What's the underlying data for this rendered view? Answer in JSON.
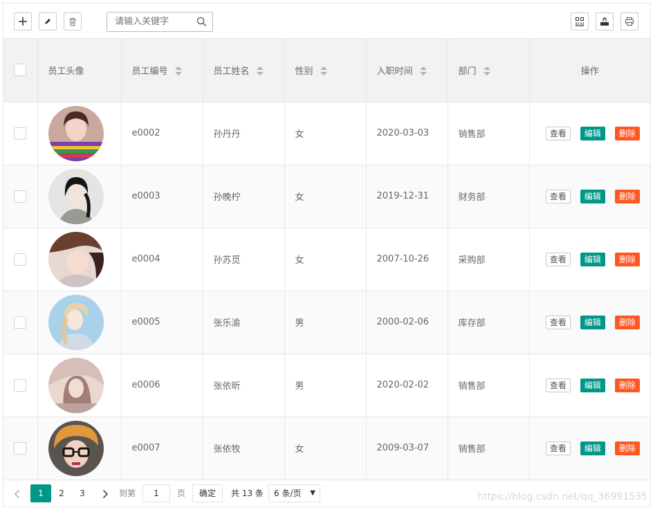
{
  "toolbar": {
    "search_placeholder": "请输入关键字"
  },
  "table": {
    "headers": {
      "avatar": "员工头像",
      "id": "员工编号",
      "name": "员工姓名",
      "gender": "性别",
      "hire_date": "入职时间",
      "dept": "部门",
      "actions": "操作"
    },
    "rows": [
      {
        "id": "e0002",
        "name": "孙丹丹",
        "gender": "女",
        "hire_date": "2020-03-03",
        "dept": "销售部"
      },
      {
        "id": "e0003",
        "name": "孙晚柠",
        "gender": "女",
        "hire_date": "2019-12-31",
        "dept": "财务部"
      },
      {
        "id": "e0004",
        "name": "孙苏觅",
        "gender": "女",
        "hire_date": "2007-10-26",
        "dept": "采购部"
      },
      {
        "id": "e0005",
        "name": "张乐渝",
        "gender": "男",
        "hire_date": "2000-02-06",
        "dept": "库存部"
      },
      {
        "id": "e0006",
        "name": "张依昕",
        "gender": "男",
        "hire_date": "2020-02-02",
        "dept": "销售部"
      },
      {
        "id": "e0007",
        "name": "张依牧",
        "gender": "女",
        "hire_date": "2009-03-07",
        "dept": "销售部"
      }
    ],
    "action_labels": {
      "view": "查看",
      "edit": "编辑",
      "delete": "删除"
    }
  },
  "pager": {
    "pages": [
      "1",
      "2",
      "3"
    ],
    "current": "1",
    "goto_prefix": "到第",
    "goto_value": "1",
    "goto_suffix": "页",
    "confirm": "确定",
    "total": "共 13 条",
    "page_size": "6 条/页"
  },
  "watermark": "https://blog.csdn.net/qq_36991535",
  "colors": {
    "accent": "#009688",
    "danger": "#ff5722",
    "header_bg": "#f2f2f2"
  }
}
